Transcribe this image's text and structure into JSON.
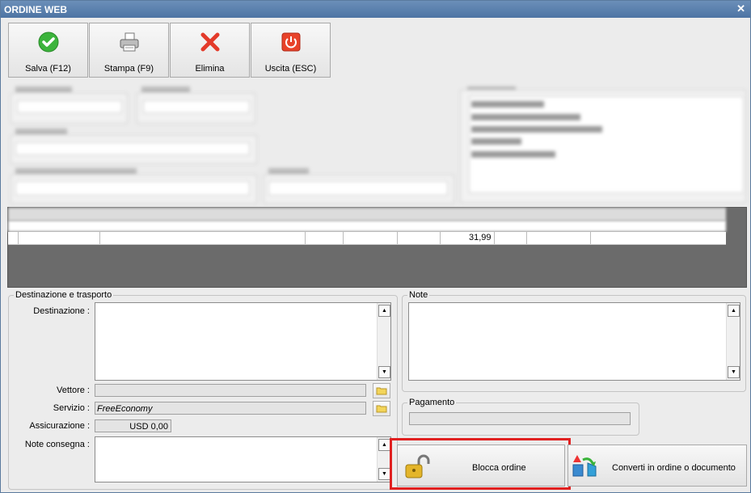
{
  "window": {
    "title": "ORDINE WEB",
    "close_glyph": "✕"
  },
  "toolbar": {
    "save_label": "Salva (F12)",
    "print_label": "Stampa (F9)",
    "delete_label": "Elimina",
    "exit_label": "Uscita (ESC)"
  },
  "grid": {
    "total_value": "31,99"
  },
  "destination_panel": {
    "title": "Destinazione e trasporto",
    "destination_label": "Destinazione :",
    "carrier_label": "Vettore :",
    "service_label": "Servizio :",
    "service_value": "FreeEconomy",
    "insurance_label": "Assicurazione :",
    "insurance_value": "USD 0,00",
    "delivery_notes_label": "Note consegna :"
  },
  "notes_panel": {
    "title": "Note"
  },
  "payment_panel": {
    "title": "Pagamento"
  },
  "actions": {
    "lock_label": "Blocca ordine",
    "convert_label": "Converti in ordine o documento",
    "highlight_color": "#e02020"
  },
  "colors": {
    "titlebar": "#5a80ae",
    "background": "#ececec"
  }
}
